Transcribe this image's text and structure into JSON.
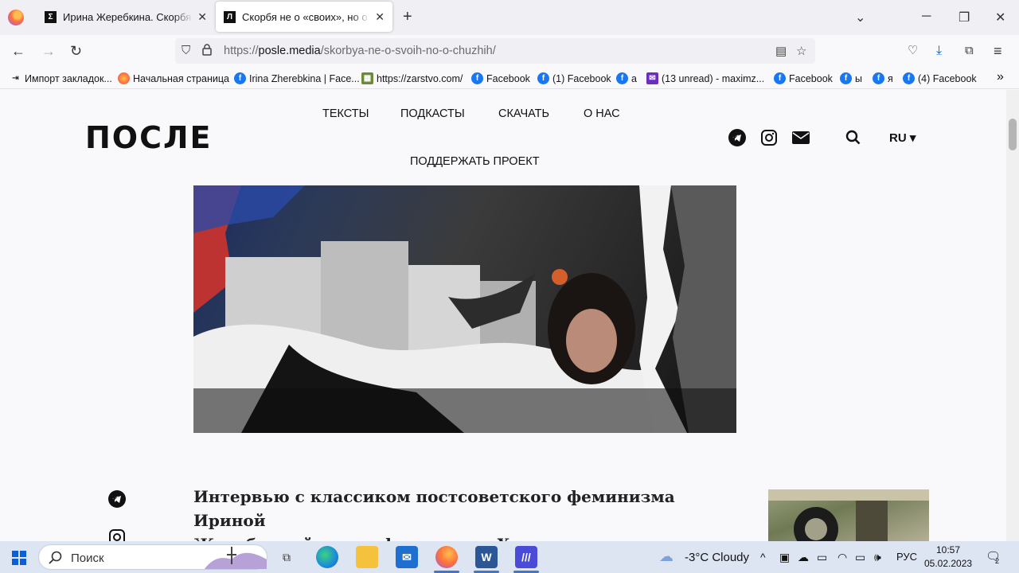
{
  "browser": {
    "tabs": [
      {
        "favicon": "Σ",
        "title": "Ирина Жеребкина. Скорбя не о «своих»",
        "active": false
      },
      {
        "favicon": "Л",
        "title": "Скорбя не о «своих», но о «чужих»",
        "active": true
      }
    ],
    "new_tab_icon": "+",
    "url_scheme": "https://",
    "url_host": "posle.media",
    "url_path": "/skorbya-ne-o-svoih-no-o-chuzhih/"
  },
  "bookmarks": [
    {
      "label": "Импорт закладок...",
      "icon": "import-icon"
    },
    {
      "label": "Начальная страница",
      "icon": "firefox-icon"
    },
    {
      "label": "Irina Zherebkina | Face...",
      "icon": "facebook-icon"
    },
    {
      "label": "https://zarstvo.com/",
      "icon": "site-icon"
    },
    {
      "label": "Facebook",
      "icon": "facebook-icon"
    },
    {
      "label": "(1) Facebook",
      "icon": "facebook-icon"
    },
    {
      "label": "а",
      "icon": "facebook-icon"
    },
    {
      "label": "(13 unread) - maximz...",
      "icon": "mail-icon"
    },
    {
      "label": "Facebook",
      "icon": "facebook-icon"
    },
    {
      "label": "ы",
      "icon": "facebook-icon"
    },
    {
      "label": "я",
      "icon": "facebook-icon"
    },
    {
      "label": "(4) Facebook",
      "icon": "facebook-icon"
    }
  ],
  "site": {
    "logo": "ПОСЛЕ",
    "menu": [
      "ТЕКСТЫ",
      "ПОДКАСТЫ",
      "СКАЧАТЬ",
      "О НАС",
      "ПОДДЕРЖАТЬ ПРОЕКТ"
    ],
    "lang": "RU"
  },
  "article": {
    "title_line1": "Интервью с классиком постсоветского феминизма Ириной",
    "title_line2": "Жеребкиной из прифронтового Харькова"
  },
  "taskbar": {
    "search_label": "Поиск",
    "weather": "-3°C  Cloudy",
    "lang": "РУС",
    "time": "10:57",
    "date": "05.02.2023",
    "notifications": "2"
  },
  "colors": {
    "accent": "#0060df",
    "facebook": "#1877f2",
    "text": "#15141a"
  }
}
